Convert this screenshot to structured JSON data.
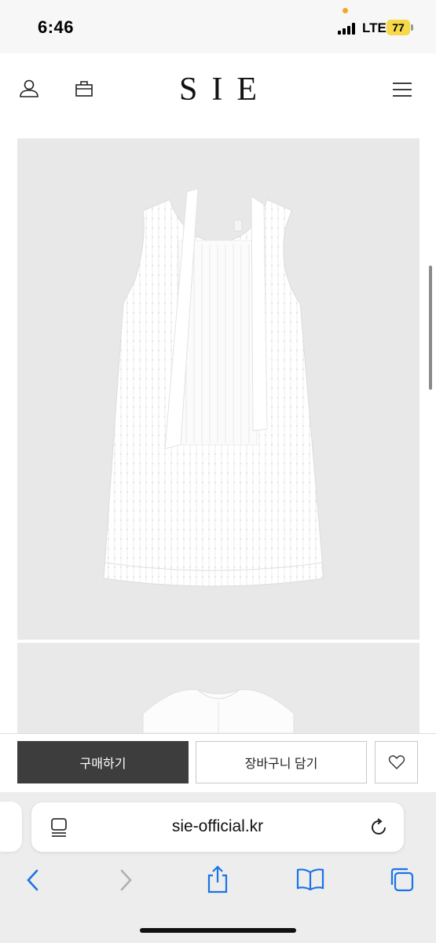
{
  "status_bar": {
    "time": "6:46",
    "network": "LTE",
    "battery": "77"
  },
  "site": {
    "logo": "SIE",
    "icons": [
      "user-icon",
      "bag-icon",
      "menu-icon"
    ]
  },
  "product": {
    "images": [
      "dress-front-image",
      "dress-back-image"
    ]
  },
  "actions": {
    "buy_label": "구매하기",
    "cart_label": "장바구니 담기",
    "wishlist_icon": "heart-icon"
  },
  "browser": {
    "url": "sie-official.kr",
    "toolbar_icons": [
      "back-icon",
      "forward-icon",
      "share-icon",
      "bookmarks-icon",
      "tabs-icon"
    ]
  },
  "colors": {
    "buy_button": "#3d3d3d",
    "battery": "#f6d94a",
    "link_blue": "#1a73e8"
  }
}
